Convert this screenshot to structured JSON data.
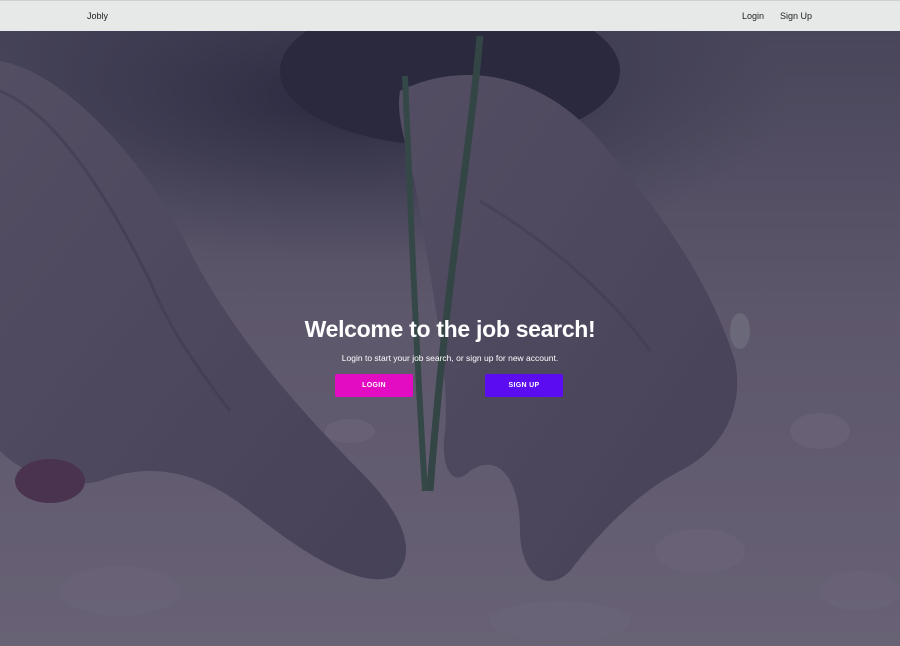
{
  "navbar": {
    "brand": "Jobly",
    "links": [
      {
        "label": "Login"
      },
      {
        "label": "Sign Up"
      }
    ]
  },
  "hero": {
    "title": "Welcome to the job search!",
    "subtitle": "Login to start your job search, or sign up for new account.",
    "login_button": "LOGIN",
    "signup_button": "SIGN UP"
  },
  "colors": {
    "navbar_bg": "#e7e8e8",
    "login_button": "#e40cc3",
    "signup_button": "#5b0cf0",
    "overlay": "#2a2a45"
  },
  "background_image": "hands-planting-seedling-in-soil"
}
